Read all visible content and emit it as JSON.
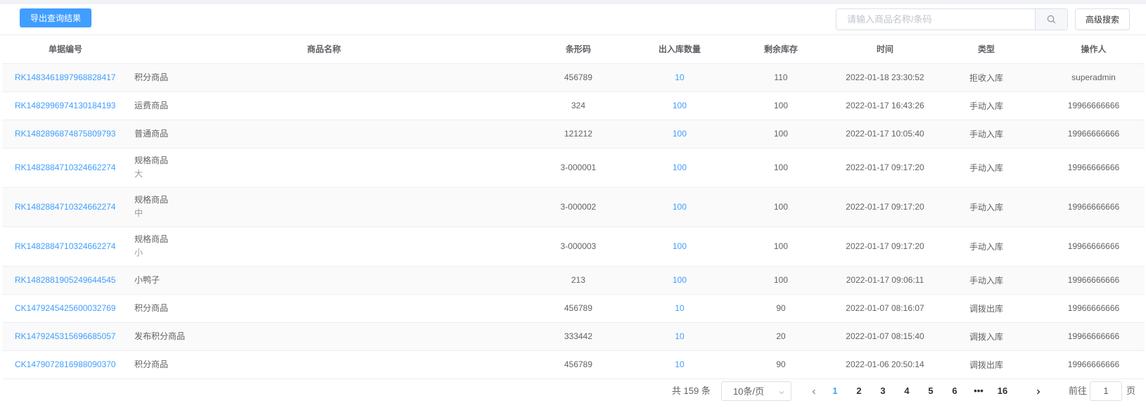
{
  "toolbar": {
    "export_label": "导出查询结果",
    "search_placeholder": "请输入商品名称/条码",
    "advanced_label": "高级搜索"
  },
  "columns": [
    "单据编号",
    "商品名称",
    "条形码",
    "出入库数量",
    "剩余库存",
    "时间",
    "类型",
    "操作人"
  ],
  "rows": [
    {
      "order": "RK1483461897968828417",
      "name": "积分商品",
      "spec": "",
      "barcode": "456789",
      "qty": "10",
      "stock": "110",
      "time": "2022-01-18 23:30:52",
      "type": "拒收入库",
      "operator": "superadmin"
    },
    {
      "order": "RK1482996974130184193",
      "name": "运费商品",
      "spec": "",
      "barcode": "324",
      "qty": "100",
      "stock": "100",
      "time": "2022-01-17 16:43:26",
      "type": "手动入库",
      "operator": "19966666666"
    },
    {
      "order": "RK1482896874875809793",
      "name": "普通商品",
      "spec": "",
      "barcode": "121212",
      "qty": "100",
      "stock": "100",
      "time": "2022-01-17 10:05:40",
      "type": "手动入库",
      "operator": "19966666666"
    },
    {
      "order": "RK1482884710324662274",
      "name": "规格商品",
      "spec": "大",
      "barcode": "3-000001",
      "qty": "100",
      "stock": "100",
      "time": "2022-01-17 09:17:20",
      "type": "手动入库",
      "operator": "19966666666"
    },
    {
      "order": "RK1482884710324662274",
      "name": "规格商品",
      "spec": "中",
      "barcode": "3-000002",
      "qty": "100",
      "stock": "100",
      "time": "2022-01-17 09:17:20",
      "type": "手动入库",
      "operator": "19966666666"
    },
    {
      "order": "RK1482884710324662274",
      "name": "规格商品",
      "spec": "小",
      "barcode": "3-000003",
      "qty": "100",
      "stock": "100",
      "time": "2022-01-17 09:17:20",
      "type": "手动入库",
      "operator": "19966666666"
    },
    {
      "order": "RK1482881905249644545",
      "name": "小鸭子",
      "spec": "",
      "barcode": "213",
      "qty": "100",
      "stock": "100",
      "time": "2022-01-17 09:06:11",
      "type": "手动入库",
      "operator": "19966666666"
    },
    {
      "order": "CK1479245425600032769",
      "name": "积分商品",
      "spec": "",
      "barcode": "456789",
      "qty": "10",
      "stock": "90",
      "time": "2022-01-07 08:16:07",
      "type": "调拨出库",
      "operator": "19966666666"
    },
    {
      "order": "RK1479245315696685057",
      "name": "发布积分商品",
      "spec": "",
      "barcode": "333442",
      "qty": "10",
      "stock": "20",
      "time": "2022-01-07 08:15:40",
      "type": "调拨入库",
      "operator": "19966666666"
    },
    {
      "order": "CK1479072816988090370",
      "name": "积分商品",
      "spec": "",
      "barcode": "456789",
      "qty": "10",
      "stock": "90",
      "time": "2022-01-06 20:50:14",
      "type": "调拨出库",
      "operator": "19966666666"
    }
  ],
  "pagination": {
    "total": "共 159 条",
    "page_size": "10条/页",
    "pages": [
      "1",
      "2",
      "3",
      "4",
      "5",
      "6",
      "•••",
      "16"
    ],
    "current": "1",
    "goto_prefix": "前往",
    "goto_value": "1",
    "goto_suffix": "页"
  }
}
